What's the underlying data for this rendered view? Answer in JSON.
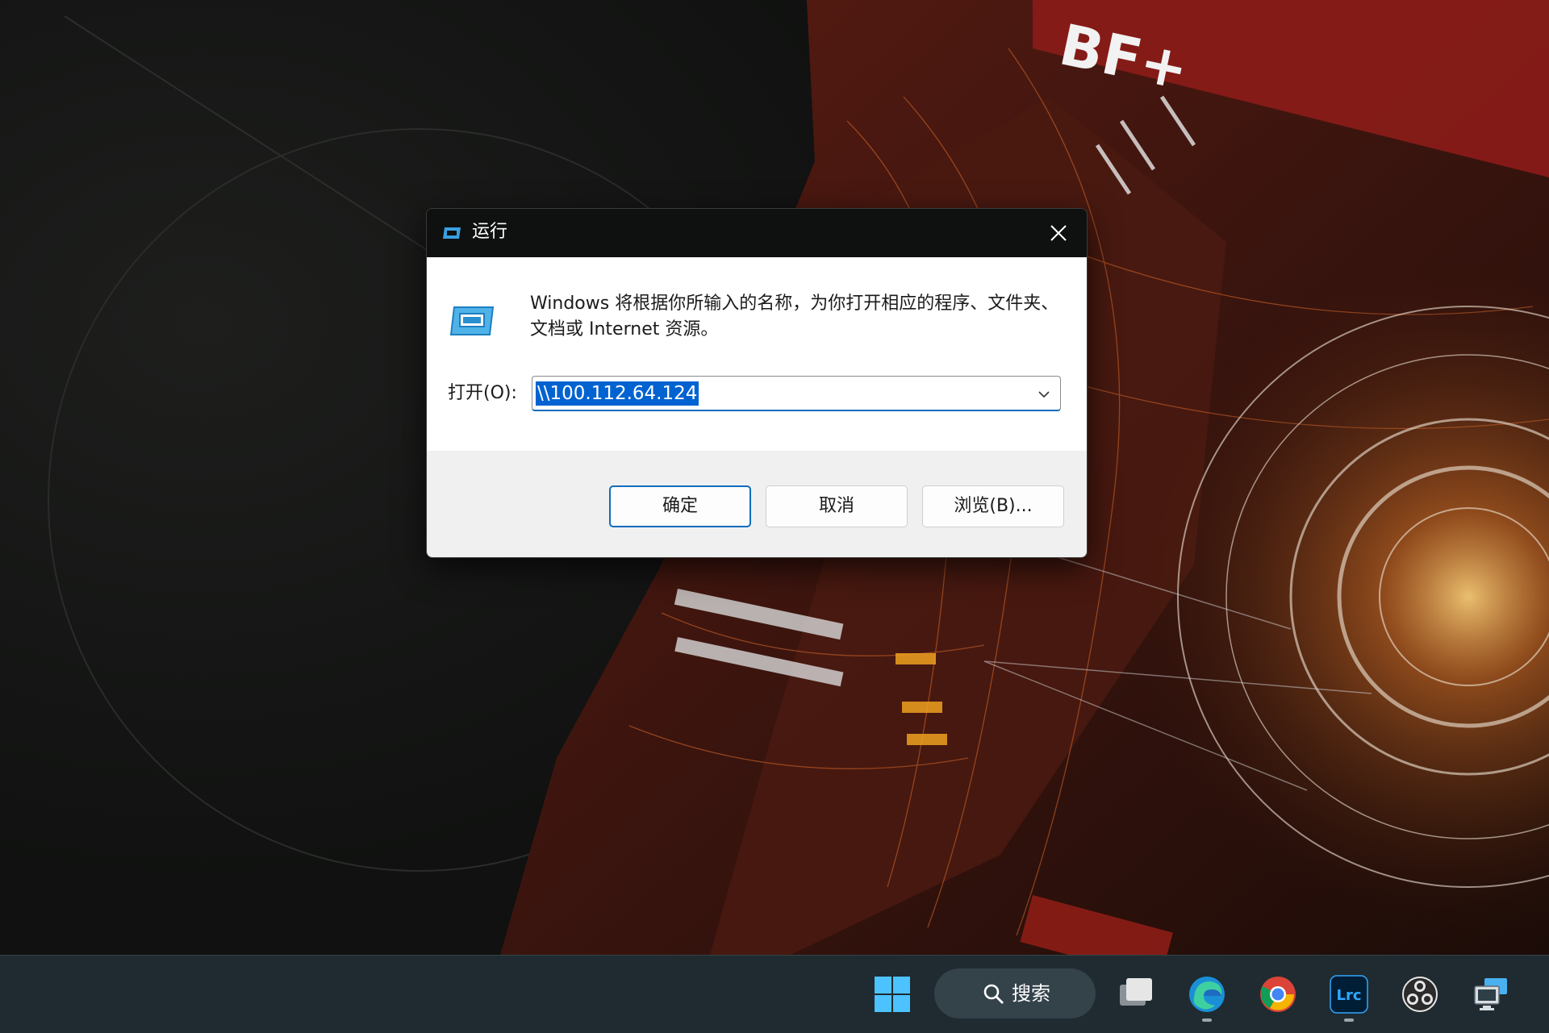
{
  "wallpaper": {
    "badge_text": "BF+"
  },
  "dialog": {
    "title": "运行",
    "close_icon": "close-icon",
    "message": "Windows 将根据你所输入的名称，为你打开相应的程序、文件夹、文档或 Internet 资源。",
    "open_label": "打开(O):",
    "open_value": "\\\\100.112.64.124",
    "buttons": {
      "ok": "确定",
      "cancel": "取消",
      "browse": "浏览(B)..."
    },
    "accent": "#0f6cbd"
  },
  "taskbar": {
    "search_label": "搜索",
    "items": [
      {
        "name": "start-button",
        "icon": "windows-logo-icon"
      },
      {
        "name": "search-box",
        "icon": "search-icon"
      },
      {
        "name": "task-view",
        "icon": "task-view-icon"
      },
      {
        "name": "edge",
        "icon": "edge-icon",
        "running": true
      },
      {
        "name": "chrome",
        "icon": "chrome-icon"
      },
      {
        "name": "lightroom-classic",
        "icon": "lrc-icon",
        "label": "Lrc",
        "running": true
      },
      {
        "name": "obs",
        "icon": "obs-icon"
      },
      {
        "name": "remote-desktop",
        "icon": "remote-desktop-icon"
      }
    ],
    "background": "#1f2b30"
  }
}
